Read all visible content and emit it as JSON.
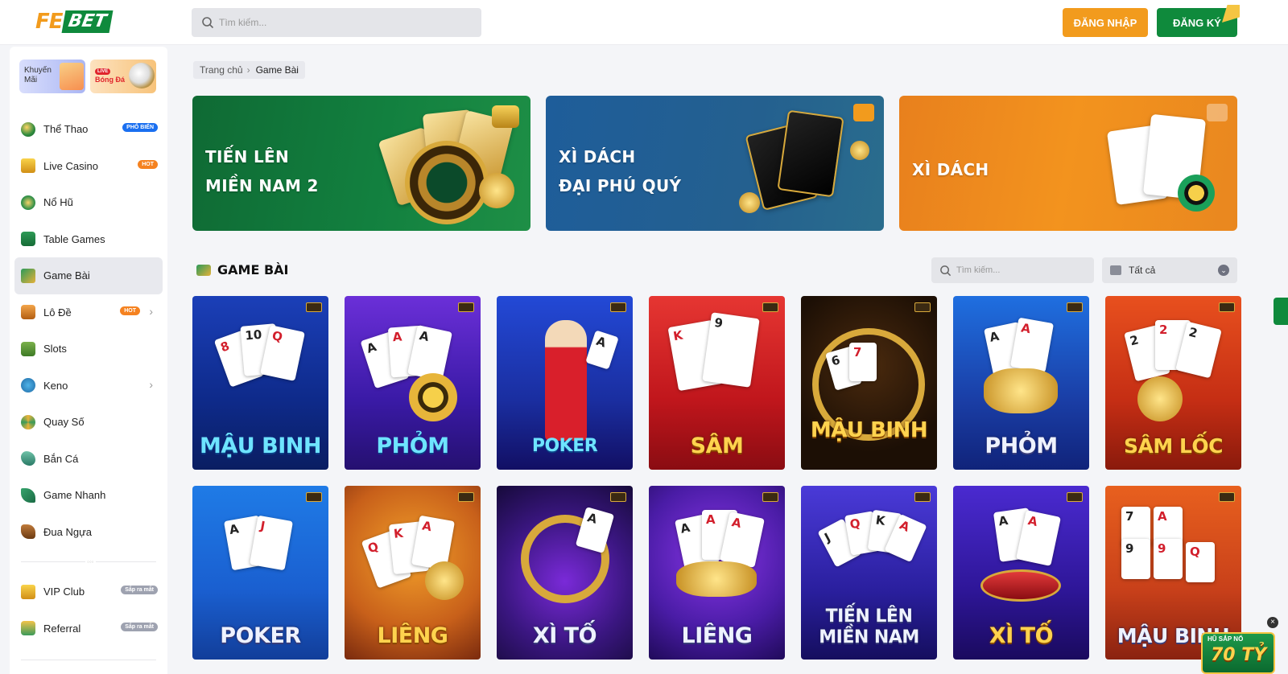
{
  "header": {
    "logo": {
      "part1": "FE",
      "part2": "BET"
    },
    "search_placeholder": "Tìm kiếm...",
    "login_label": "ĐĂNG NHẬP",
    "register_label": "ĐĂNG KÝ"
  },
  "sidebar": {
    "promos": [
      {
        "label": "Khuyến Mãi"
      },
      {
        "live": "LIVE",
        "label": "Bóng Đá"
      }
    ],
    "items": [
      {
        "label": "Thể Thao",
        "badge": "PHỔ BIẾN",
        "icon": "soccer-ball-icon"
      },
      {
        "label": "Live Casino",
        "badge": "HOT",
        "icon": "crown-icon"
      },
      {
        "label": "Nổ Hũ",
        "icon": "jackpot-icon"
      },
      {
        "label": "Table Games",
        "icon": "table-icon"
      },
      {
        "label": "Game Bài",
        "icon": "cards-icon",
        "active": true
      },
      {
        "label": "Lô Đề",
        "badge": "HOT",
        "icon": "lottery-icon",
        "chevron": true
      },
      {
        "label": "Slots",
        "icon": "slots-icon"
      },
      {
        "label": "Keno",
        "icon": "keno-icon",
        "chevron": true
      },
      {
        "label": "Quay Số",
        "icon": "wheel-icon"
      },
      {
        "label": "Bắn Cá",
        "icon": "fish-icon"
      },
      {
        "label": "Game Nhanh",
        "icon": "rocket-icon"
      },
      {
        "label": "Đua Ngựa",
        "icon": "horse-icon"
      }
    ],
    "extra_items": [
      {
        "label": "VIP Club",
        "badge": "Sắp ra mắt",
        "icon": "crown-icon"
      },
      {
        "label": "Referral",
        "badge": "Sắp ra mắt",
        "icon": "referral-icon"
      }
    ]
  },
  "breadcrumb": {
    "home": "Trang chủ",
    "sep": "›",
    "current": "Game Bài"
  },
  "banners": [
    {
      "line1": "TIẾN LÊN",
      "line2": "MIỀN NAM 2"
    },
    {
      "line1": "XÌ DÁCH",
      "line2": "ĐẠI PHÚ QUÝ"
    },
    {
      "line1": "XÌ DÁCH",
      "line2": ""
    }
  ],
  "section": {
    "title": "GAME BÀI",
    "search_placeholder": "Tìm kiếm...",
    "filter_value": "Tất cả"
  },
  "games": [
    {
      "name": "MẬU BINH"
    },
    {
      "name": "PHỎM"
    },
    {
      "name": "POKER"
    },
    {
      "name": "SÂM"
    },
    {
      "name": "MẬU BINH"
    },
    {
      "name": "PHỎM"
    },
    {
      "name": "SÂM LỐC"
    },
    {
      "name": "POKER"
    },
    {
      "name": "LIÊNG"
    },
    {
      "name": "XÌ TỐ"
    },
    {
      "name": "LIÊNG"
    },
    {
      "name": "TIẾN LÊN MIỀN NAM"
    },
    {
      "name": "XÌ TỐ"
    },
    {
      "name": "MẬU BINH"
    }
  ],
  "jackpot": {
    "line1": "HŨ SẮP NỔ",
    "line2": "70 TỶ"
  },
  "colors": {
    "brand_orange": "#f29b1d",
    "brand_green": "#0f8a3c",
    "badge_blue": "#1a6ff0",
    "badge_orange": "#f58220"
  }
}
